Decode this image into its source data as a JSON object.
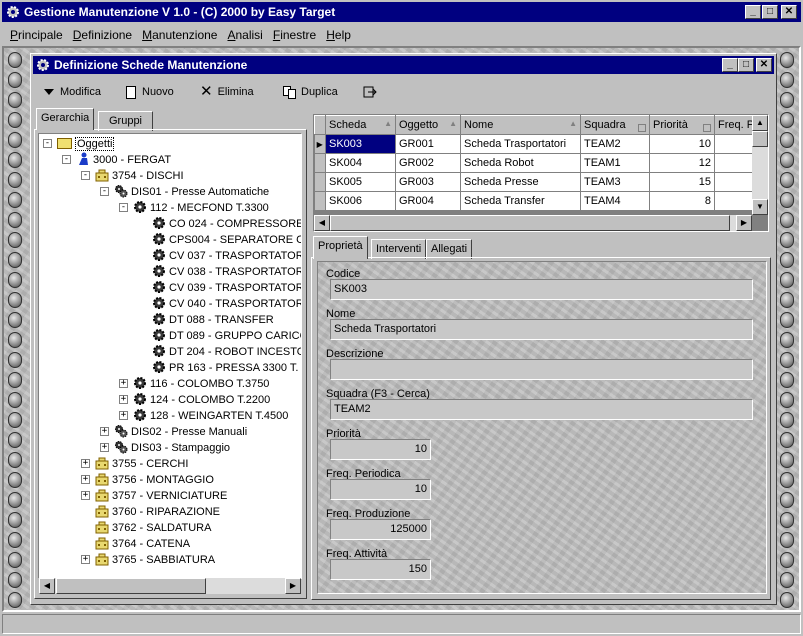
{
  "app": {
    "title": "Gestione Manutenzione V 1.0 - (C) 2000 by Easy Target",
    "menu": [
      "Principale",
      "Definizione",
      "Manutenzione",
      "Analisi",
      "Finestre",
      "Help"
    ]
  },
  "child_window": {
    "title": "Definizione Schede Manutenzione",
    "toolbar": {
      "modifica": "Modifica",
      "nuovo": "Nuovo",
      "elimina": "Elimina",
      "duplica": "Duplica"
    }
  },
  "left_tabs": [
    "Gerarchia",
    "Gruppi"
  ],
  "tree": [
    {
      "label": "Oggetti",
      "icon": "folder-icon",
      "level": 0,
      "expander": "-",
      "selected": true
    },
    {
      "label": "3000 - FERGAT",
      "icon": "worker-icon",
      "level": 1,
      "expander": "-"
    },
    {
      "label": "3754 - DISCHI",
      "icon": "building-icon",
      "level": 2,
      "expander": "-"
    },
    {
      "label": "DIS01 - Presse Automatiche",
      "icon": "gears-icon",
      "level": 3,
      "expander": "-"
    },
    {
      "label": "112 - MECFOND T.3300",
      "icon": "gear-icon",
      "level": 4,
      "expander": "-"
    },
    {
      "label": "CO 024 - COMPRESSORE",
      "icon": "gear-icon",
      "level": 5,
      "expander": ""
    },
    {
      "label": "CPS004 - SEPARATORE C",
      "icon": "gear-icon",
      "level": 5,
      "expander": ""
    },
    {
      "label": "CV 037 - TRASPORTATOR",
      "icon": "gear-icon",
      "level": 5,
      "expander": ""
    },
    {
      "label": "CV 038 - TRASPORTATOR",
      "icon": "gear-icon",
      "level": 5,
      "expander": ""
    },
    {
      "label": "CV 039 - TRASPORTATOR",
      "icon": "gear-icon",
      "level": 5,
      "expander": ""
    },
    {
      "label": "CV 040 - TRASPORTATOR",
      "icon": "gear-icon",
      "level": 5,
      "expander": ""
    },
    {
      "label": "DT 088 - TRANSFER",
      "icon": "gear-icon",
      "level": 5,
      "expander": ""
    },
    {
      "label": "DT 089 - GRUPPO CARICO",
      "icon": "gear-icon",
      "level": 5,
      "expander": ""
    },
    {
      "label": "DT 204 - ROBOT INCESTO",
      "icon": "gear-icon",
      "level": 5,
      "expander": ""
    },
    {
      "label": "PR 163 - PRESSA 3300 T.",
      "icon": "gear-icon",
      "level": 5,
      "expander": ""
    },
    {
      "label": "116 - COLOMBO T.3750",
      "icon": "gear-icon",
      "level": 4,
      "expander": "+"
    },
    {
      "label": "124 - COLOMBO T.2200",
      "icon": "gear-icon",
      "level": 4,
      "expander": "+"
    },
    {
      "label": "128 - WEINGARTEN T.4500",
      "icon": "gear-icon",
      "level": 4,
      "expander": "+"
    },
    {
      "label": "DIS02 - Presse Manuali",
      "icon": "gears-icon",
      "level": 3,
      "expander": "+"
    },
    {
      "label": "DIS03 - Stampaggio",
      "icon": "gears-icon",
      "level": 3,
      "expander": "+"
    },
    {
      "label": "3755 - CERCHI",
      "icon": "building-icon",
      "level": 2,
      "expander": "+"
    },
    {
      "label": "3756 - MONTAGGIO",
      "icon": "building-icon",
      "level": 2,
      "expander": "+"
    },
    {
      "label": "3757 - VERNICIATURE",
      "icon": "building-icon",
      "level": 2,
      "expander": "+"
    },
    {
      "label": "3760 - RIPARAZIONE",
      "icon": "building-icon",
      "level": 2,
      "expander": ""
    },
    {
      "label": "3762 - SALDATURA",
      "icon": "building-icon",
      "level": 2,
      "expander": ""
    },
    {
      "label": "3764 - CATENA",
      "icon": "building-icon",
      "level": 2,
      "expander": ""
    },
    {
      "label": "3765 - SABBIATURA",
      "icon": "building-icon",
      "level": 2,
      "expander": "+"
    }
  ],
  "grid": {
    "columns": [
      "Scheda",
      "Oggetto",
      "Nome",
      "Squadra",
      "Priorità",
      "Freq. P"
    ],
    "rows": [
      [
        "SK003",
        "GR001",
        "Scheda Trasportatori",
        "TEAM2",
        "10",
        ""
      ],
      [
        "SK004",
        "GR002",
        "Scheda Robot",
        "TEAM1",
        "12",
        ""
      ],
      [
        "SK005",
        "GR003",
        "Scheda Presse",
        "TEAM3",
        "15",
        ""
      ],
      [
        "SK006",
        "GR004",
        "Scheda Transfer",
        "TEAM4",
        "8",
        ""
      ]
    ]
  },
  "detail_tabs": [
    "Proprietà",
    "Interventi",
    "Allegati"
  ],
  "form": {
    "codice_label": "Codice",
    "codice": "SK003",
    "nome_label": "Nome",
    "nome": "Scheda Trasportatori",
    "descrizione_label": "Descrizione",
    "descrizione": "",
    "squadra_label": "Squadra (F3 - Cerca)",
    "squadra": "TEAM2",
    "priorita_label": "Priorità",
    "priorita": "10",
    "freq_periodica_label": "Freq. Periodica",
    "freq_periodica": "10",
    "freq_produzione_label": "Freq. Produzione",
    "freq_produzione": "125000",
    "freq_attivita_label": "Freq. Attività",
    "freq_attivita": "150"
  }
}
